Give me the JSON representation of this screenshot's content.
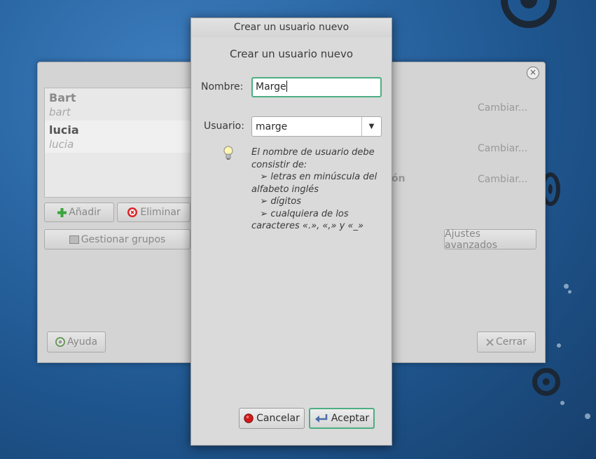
{
  "accounts_window": {
    "users": [
      {
        "name": "Bart",
        "login": "bart"
      },
      {
        "name": "lucia",
        "login": "lucia"
      }
    ],
    "add_label": "Añadir",
    "remove_label": "Eliminar",
    "manage_groups_label": "Gestionar grupos",
    "change_links": [
      "Cambiar...",
      "Cambiar...",
      "Cambiar..."
    ],
    "partial_label": "ón",
    "advanced_label": "Ajustes avanzados",
    "help_label": "Ayuda",
    "close_label": "Cerrar"
  },
  "dialog": {
    "title": "Crear un usuario nuevo",
    "heading": "Crear un usuario nuevo",
    "name_label": "Nombre:",
    "name_value": "Marge",
    "username_label": "Usuario:",
    "username_value": "marge",
    "hint": [
      "El nombre de usuario debe",
      "consistir de:",
      "   ➢ letras en minúscula del",
      "alfabeto inglés",
      "   ➢ dígitos",
      "   ➢ cualquiera de los",
      "caracteres «.», «,» y «_»"
    ],
    "cancel_label": "Cancelar",
    "accept_label": "Aceptar"
  },
  "icons": {
    "add": "plus-icon",
    "remove": "remove-icon",
    "groups": "groups-icon",
    "help": "help-icon",
    "close": "close-icon",
    "hint": "lightbulb-icon",
    "cancel": "stop-icon",
    "accept": "enter-icon"
  },
  "colors": {
    "focus_accent": "#4cae82",
    "add_icon": "#3aa53a",
    "remove_icon": "#d9262b",
    "desktop": "#2d6aa8"
  }
}
